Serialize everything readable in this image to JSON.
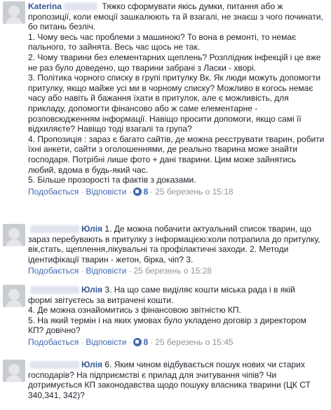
{
  "comments": [
    {
      "author": "Katerina",
      "lines": [
        "Тяжко сформувати якісь думки, питання або ж",
        "пропозиції, коли емоції зашкалюють та й взагалі, не знаєш з чого починати,",
        "бо питань безліч.",
        "1. Чому весь час проблеми з машиною? То вона в ремонті, то немає",
        "пального, то зайнята. Весь час щось не так.",
        "2. Чому тварини без елементарних щеплень? Розплідник інфекцій і це вже",
        "не раз було доведено, що тварини забрані з Ласки - хворі.",
        "3. Політика чорного списку в групі притулку Вк. Як люди можуть допомогти",
        "притулку, якщо майже усі ми в чорному списку? Можливо в когось немає",
        "часу або навіть й бажання їхати в притулок, але є можливість, для",
        "прикладу, допомогти фінансово або ж саме елементарне -",
        "розповсюдженням інформації. Навіщо просити допомоги, якщо самі її",
        "відхиляєте? Навіщо тоді взагалі та група?",
        "4. Пропозиція : зараз є багато сайтів, де можна реєструвати тварин, робити",
        "їхні анкети, сайти з оголошеннями, де реально тварина може знайти",
        "господаря. Потрібні лише фото + дані тварини. Цим може зайнятись",
        "любий, вдома в будь-який час.",
        "5. Більше прозорості та фактів з доказами."
      ],
      "like_label": "Подобається",
      "reply_label": "Відповісти",
      "likes": "8",
      "timestamp": "25 березень о 15:18"
    },
    {
      "author": "Юлія",
      "lines": [
        "1. Де можна побачити актуальний список тварин, що",
        "зараз перебувають в притулку з інформацією:коли потрапила до притулку,",
        "вік,стать, щеплення,лікувальні та профілактичні заходи. 2. Методи",
        "ідентифікації тварин - жетон, бірка, чіп? 3."
      ],
      "like_label": "Подобається",
      "reply_label": "Відповісти",
      "likes": "",
      "timestamp": "25 березень о 15:28"
    },
    {
      "author": "Юлія",
      "lines": [
        "3. На що саме виділяє кошти міська рада і в якій",
        "формі звітуєтесь за витрачені кошти.",
        "4. Де можна ознайомитись з фінансовою звітністю КП.",
        "5. На який термін і на яких умовах було укладено договір з директором",
        "КП? довічно?"
      ],
      "like_label": "Подобається",
      "reply_label": "Відповісти",
      "likes": "8",
      "timestamp": "25 березень о 15:45"
    },
    {
      "author": "Юлія",
      "lines": [
        "6. Яким чином відбувається пошук нових чи старих",
        "господарів? На підприємстві є прилад для зчитування чіпів? Чи",
        "дотримується КП законодавства щодо пошуку власника тварини (ЦК СТ",
        "340,341, 342)?"
      ]
    }
  ]
}
